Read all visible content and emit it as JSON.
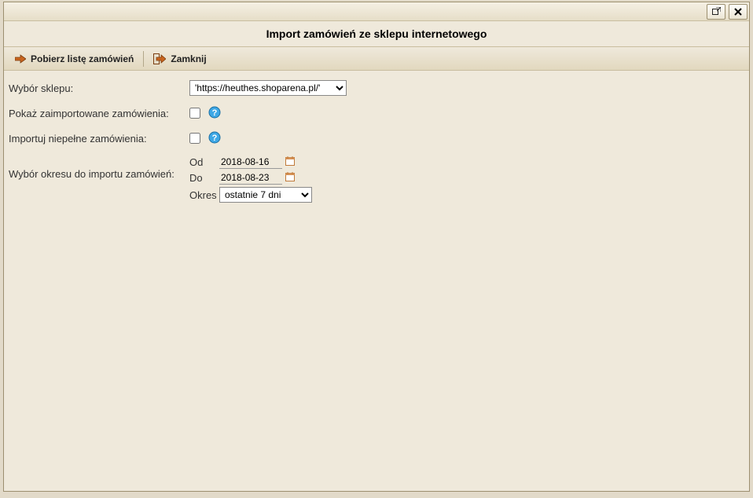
{
  "title": "Import zamówień ze sklepu internetowego",
  "toolbar": {
    "fetch_label": "Pobierz listę zamówień",
    "close_label": "Zamknij"
  },
  "form": {
    "shop_label": "Wybór sklepu:",
    "shop_value": "'https://heuthes.shoparena.pl/'",
    "show_imported_label": "Pokaż zaimportowane zamówienia:",
    "import_incomplete_label": "Importuj niepełne zamówienia:",
    "period_label": "Wybór okresu do importu zamówień:",
    "date_from_label": "Od",
    "date_to_label": "Do",
    "period_range_label": "Okres",
    "date_from_value": "2018-08-16",
    "date_to_value": "2018-08-23",
    "period_range_value": "ostatnie 7 dni"
  }
}
